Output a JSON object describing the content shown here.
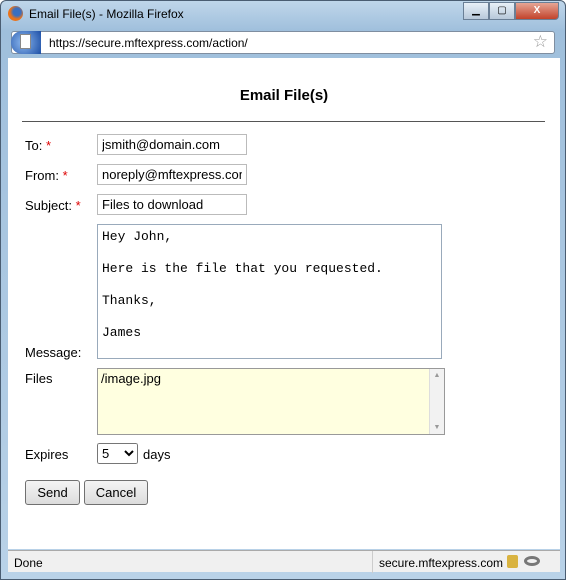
{
  "window": {
    "title": "Email File(s) - Mozilla Firefox",
    "url": "https://secure.mftexpress.com/action/"
  },
  "form": {
    "heading": "Email File(s)",
    "to_label": "To:",
    "to_value": "jsmith@domain.com",
    "from_label": "From:",
    "from_value": "noreply@mftexpress.com",
    "subject_label": "Subject:",
    "subject_value": "Files to download",
    "required_mark": "*",
    "message_label": "Message:",
    "message_value": "Hey John,\n\nHere is the file that you requested.\n\nThanks,\n\nJames",
    "files_label": "Files",
    "files_value": "/image.jpg",
    "expires_label": "Expires",
    "expires_value": "5",
    "expires_unit": "days",
    "send_label": "Send",
    "cancel_label": "Cancel"
  },
  "status": {
    "text": "Done",
    "host": "secure.mftexpress.com"
  }
}
